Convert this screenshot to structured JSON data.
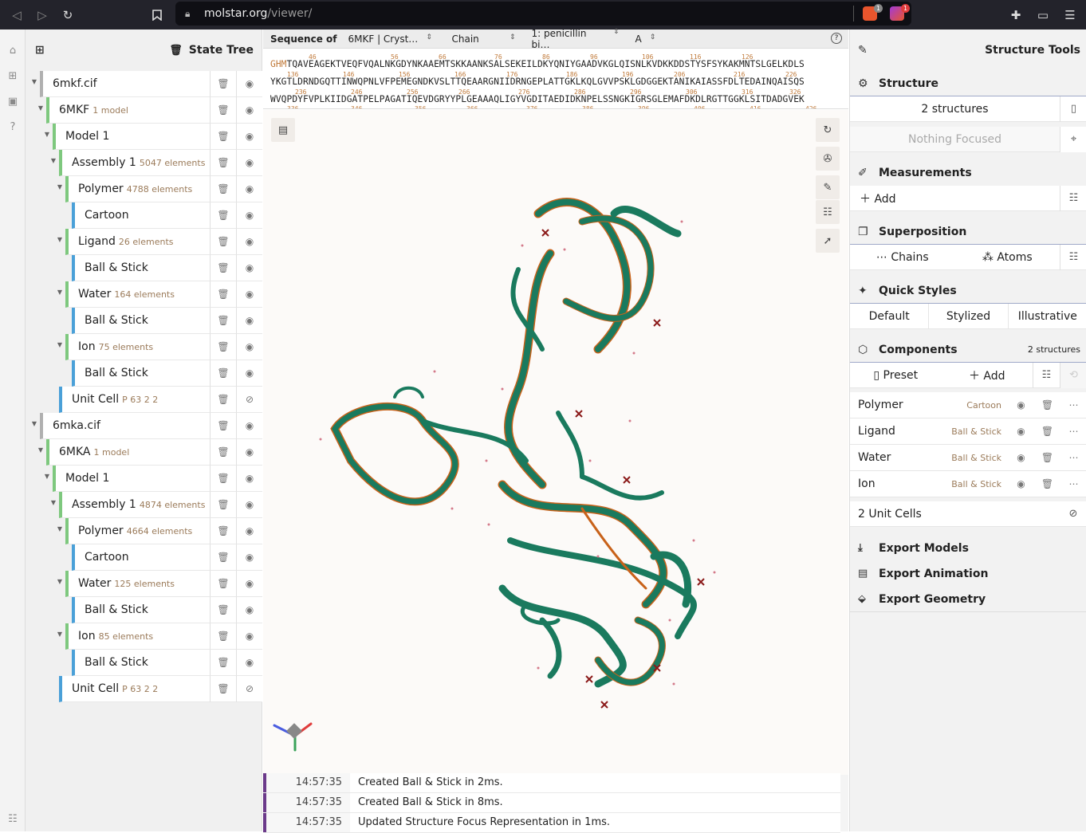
{
  "browser": {
    "url_host": "molstar.org",
    "url_path": "/viewer/",
    "shield_badge": "1",
    "alert_badge": "1"
  },
  "state_tree": {
    "title": "State Tree",
    "rows": [
      {
        "label": "6mkf.cif",
        "meta": "",
        "caret": "▼",
        "hidden": false
      },
      {
        "label": "6MKF",
        "meta": "1 model",
        "caret": "▼",
        "hidden": false
      },
      {
        "label": "Model 1",
        "meta": "",
        "caret": "▼",
        "hidden": false
      },
      {
        "label": "Assembly 1",
        "meta": "5047 elements",
        "caret": "▼",
        "hidden": false
      },
      {
        "label": "Polymer",
        "meta": "4788 elements",
        "caret": "▼",
        "hidden": false
      },
      {
        "label": "Cartoon",
        "meta": "",
        "caret": "",
        "hidden": false
      },
      {
        "label": "Ligand",
        "meta": "26 elements",
        "caret": "▼",
        "hidden": false
      },
      {
        "label": "Ball & Stick",
        "meta": "",
        "caret": "",
        "hidden": false
      },
      {
        "label": "Water",
        "meta": "164 elements",
        "caret": "▼",
        "hidden": false
      },
      {
        "label": "Ball & Stick",
        "meta": "",
        "caret": "",
        "hidden": false
      },
      {
        "label": "Ion",
        "meta": "75 elements",
        "caret": "▼",
        "hidden": false
      },
      {
        "label": "Ball & Stick",
        "meta": "",
        "caret": "",
        "hidden": false
      },
      {
        "label": "Unit Cell",
        "meta": "P 63 2 2",
        "caret": "",
        "hidden": true
      },
      {
        "label": "6mka.cif",
        "meta": "",
        "caret": "▼",
        "hidden": false
      },
      {
        "label": "6MKA",
        "meta": "1 model",
        "caret": "▼",
        "hidden": false
      },
      {
        "label": "Model 1",
        "meta": "",
        "caret": "▼",
        "hidden": false
      },
      {
        "label": "Assembly 1",
        "meta": "4874 elements",
        "caret": "▼",
        "hidden": false
      },
      {
        "label": "Polymer",
        "meta": "4664 elements",
        "caret": "▼",
        "hidden": false
      },
      {
        "label": "Cartoon",
        "meta": "",
        "caret": "",
        "hidden": false
      },
      {
        "label": "Water",
        "meta": "125 elements",
        "caret": "▼",
        "hidden": false
      },
      {
        "label": "Ball & Stick",
        "meta": "",
        "caret": "",
        "hidden": false
      },
      {
        "label": "Ion",
        "meta": "85 elements",
        "caret": "▼",
        "hidden": false
      },
      {
        "label": "Ball & Stick",
        "meta": "",
        "caret": "",
        "hidden": false
      },
      {
        "label": "Unit Cell",
        "meta": "P 63 2 2",
        "caret": "",
        "hidden": true
      }
    ]
  },
  "sequence": {
    "label": "Sequence of",
    "entry": "6MKF | Cryst…",
    "mode": "Chain",
    "entity": "1: penicillin bi…",
    "chain": "A",
    "line1_prefix": "GHM",
    "line1": "TQAVEAGEKTVEQFVQALNKGDYNKAAEMTSKKAANKSALSEKEILDKYQNIYGAADVKGLQISNLKVDKKDDSTYSFSYKAKMNTSLGELKDLS",
    "line2": "YKGTLDRNDGQTTINWQPNLVFPEMEGNDKVSLTTQEAARGNIIDRNGEPLATTGKLKQLGVVPSKLGDGGEKTANIKAIASSFDLTEDAINQAISQS",
    "line3": "WVQPDYFVPLKIIDGATPELPAGATIQEVDGRYYPLGEAAAQLIGYVGDITAEDIDKNPELSSNGKIGRSGLEMAFDKDLRGTTGGKLSITDADGVEK",
    "nums1": [
      "46",
      "56",
      "66",
      "76",
      "86",
      "96",
      "106",
      "116",
      "126"
    ],
    "nums2": [
      "136",
      "146",
      "156",
      "166",
      "176",
      "186",
      "196",
      "206",
      "216",
      "226"
    ],
    "nums3": [
      "236",
      "246",
      "256",
      "266",
      "276",
      "286",
      "296",
      "306",
      "316",
      "326"
    ],
    "nums4": [
      "336",
      "346",
      "356",
      "366",
      "376",
      "386",
      "396",
      "406",
      "416",
      "426"
    ]
  },
  "log": [
    {
      "time": "14:57:35",
      "message": "Created Ball & Stick in 2ms."
    },
    {
      "time": "14:57:35",
      "message": "Created Ball & Stick in 8ms."
    },
    {
      "time": "14:57:35",
      "message": "Updated Structure Focus Representation in 1ms."
    }
  ],
  "structure_tools": {
    "title": "Structure Tools",
    "structure": {
      "title": "Structure",
      "count": "2 structures",
      "focus": "Nothing Focused"
    },
    "measurements": {
      "title": "Measurements",
      "add": "Add"
    },
    "superposition": {
      "title": "Superposition",
      "chains": "Chains",
      "atoms": "Atoms"
    },
    "quick_styles": {
      "title": "Quick Styles",
      "default": "Default",
      "stylized": "Stylized",
      "illustrative": "Illustrative"
    },
    "components": {
      "title": "Components",
      "count": "2 structures",
      "preset": "Preset",
      "add": "Add",
      "items": [
        {
          "name": "Polymer",
          "repr": "Cartoon"
        },
        {
          "name": "Ligand",
          "repr": "Ball & Stick"
        },
        {
          "name": "Water",
          "repr": "Ball & Stick"
        },
        {
          "name": "Ion",
          "repr": "Ball & Stick"
        }
      ],
      "unit_cells": "2 Unit Cells"
    },
    "export_models": "Export Models",
    "export_animation": "Export Animation",
    "export_geometry": "Export Geometry"
  },
  "colors": {
    "protein_a": "#1a7a5e",
    "protein_b": "#c8621a",
    "log_bar": "#6b3a8a",
    "accent_line": "#9fa9c8"
  }
}
